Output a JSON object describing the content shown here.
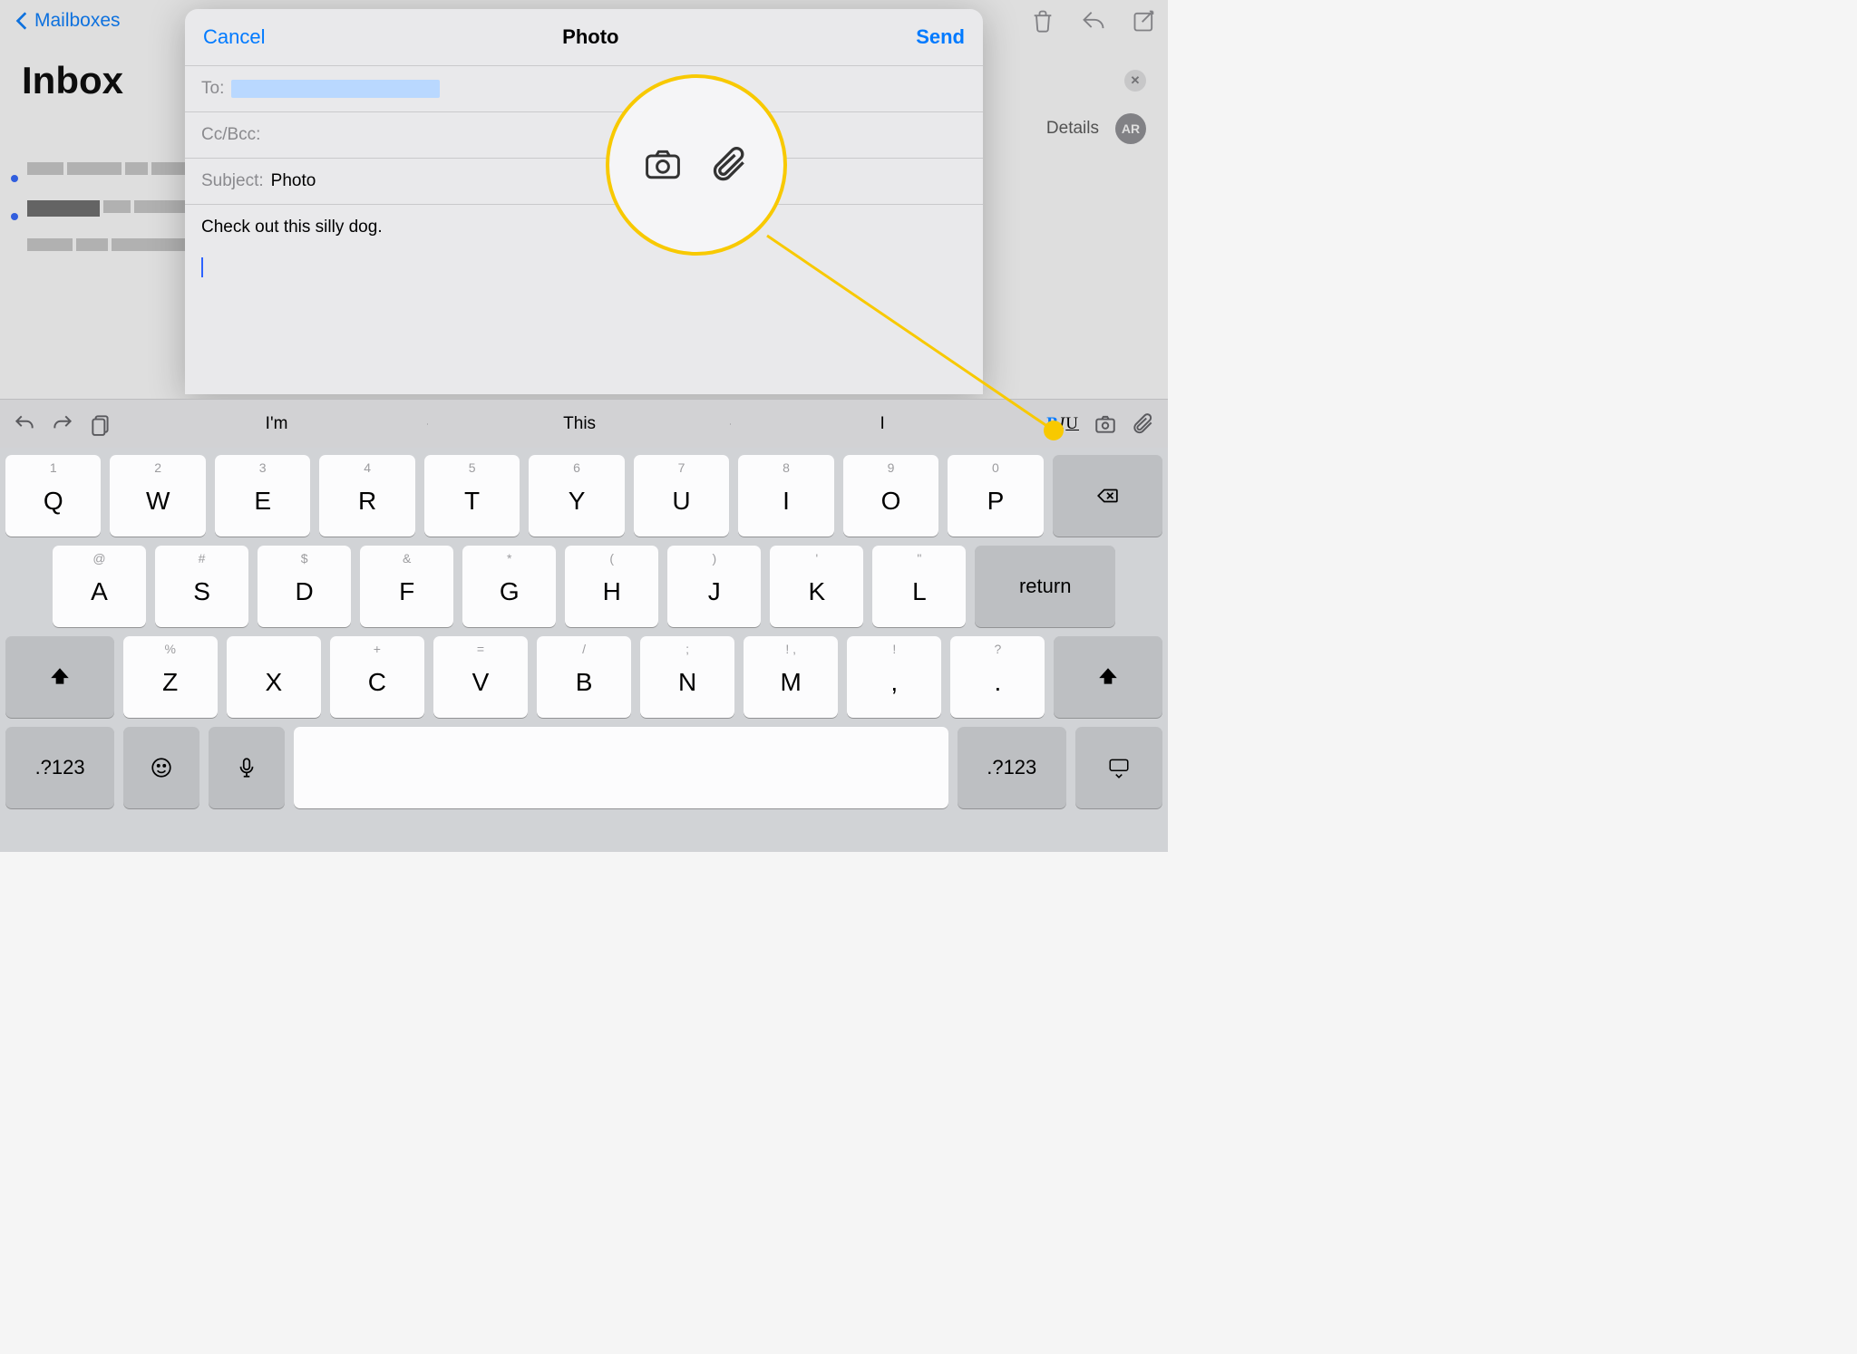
{
  "background": {
    "back_label": "Mailboxes",
    "inbox_title": "Inbox",
    "details_label": "Details",
    "avatar_initials": "AR"
  },
  "compose": {
    "cancel": "Cancel",
    "title": "Photo",
    "send": "Send",
    "to_label": "To:",
    "cc_label": "Cc/Bcc:",
    "subject_label": "Subject:",
    "subject_value": "Photo",
    "body_text": "Check out this silly dog."
  },
  "quicktype": {
    "suggestions": [
      "I'm",
      "This",
      "I"
    ]
  },
  "keyboard": {
    "row1": [
      {
        "sub": "1",
        "main": "Q"
      },
      {
        "sub": "2",
        "main": "W"
      },
      {
        "sub": "3",
        "main": "E"
      },
      {
        "sub": "4",
        "main": "R"
      },
      {
        "sub": "5",
        "main": "T"
      },
      {
        "sub": "6",
        "main": "Y"
      },
      {
        "sub": "7",
        "main": "U"
      },
      {
        "sub": "8",
        "main": "I"
      },
      {
        "sub": "9",
        "main": "O"
      },
      {
        "sub": "0",
        "main": "P"
      }
    ],
    "row2": [
      {
        "sub": "@",
        "main": "A"
      },
      {
        "sub": "#",
        "main": "S"
      },
      {
        "sub": "$",
        "main": "D"
      },
      {
        "sub": "&",
        "main": "F"
      },
      {
        "sub": "*",
        "main": "G"
      },
      {
        "sub": "(",
        "main": "H"
      },
      {
        "sub": ")",
        "main": "J"
      },
      {
        "sub": "'",
        "main": "K"
      },
      {
        "sub": "\"",
        "main": "L"
      }
    ],
    "row3": [
      {
        "sub": "%",
        "main": "Z"
      },
      {
        "sub": "",
        "main": "X"
      },
      {
        "sub": "+",
        "main": "C"
      },
      {
        "sub": "=",
        "main": "V"
      },
      {
        "sub": "/",
        "main": "B"
      },
      {
        "sub": ";",
        "main": "N"
      },
      {
        "sub": "!\n,",
        "main": "M"
      }
    ],
    "punct1": {
      "sub": "!",
      "main": ","
    },
    "punct2": {
      "sub": "?",
      "main": "."
    },
    "sym_label": ".?123",
    "return_label": "return"
  }
}
